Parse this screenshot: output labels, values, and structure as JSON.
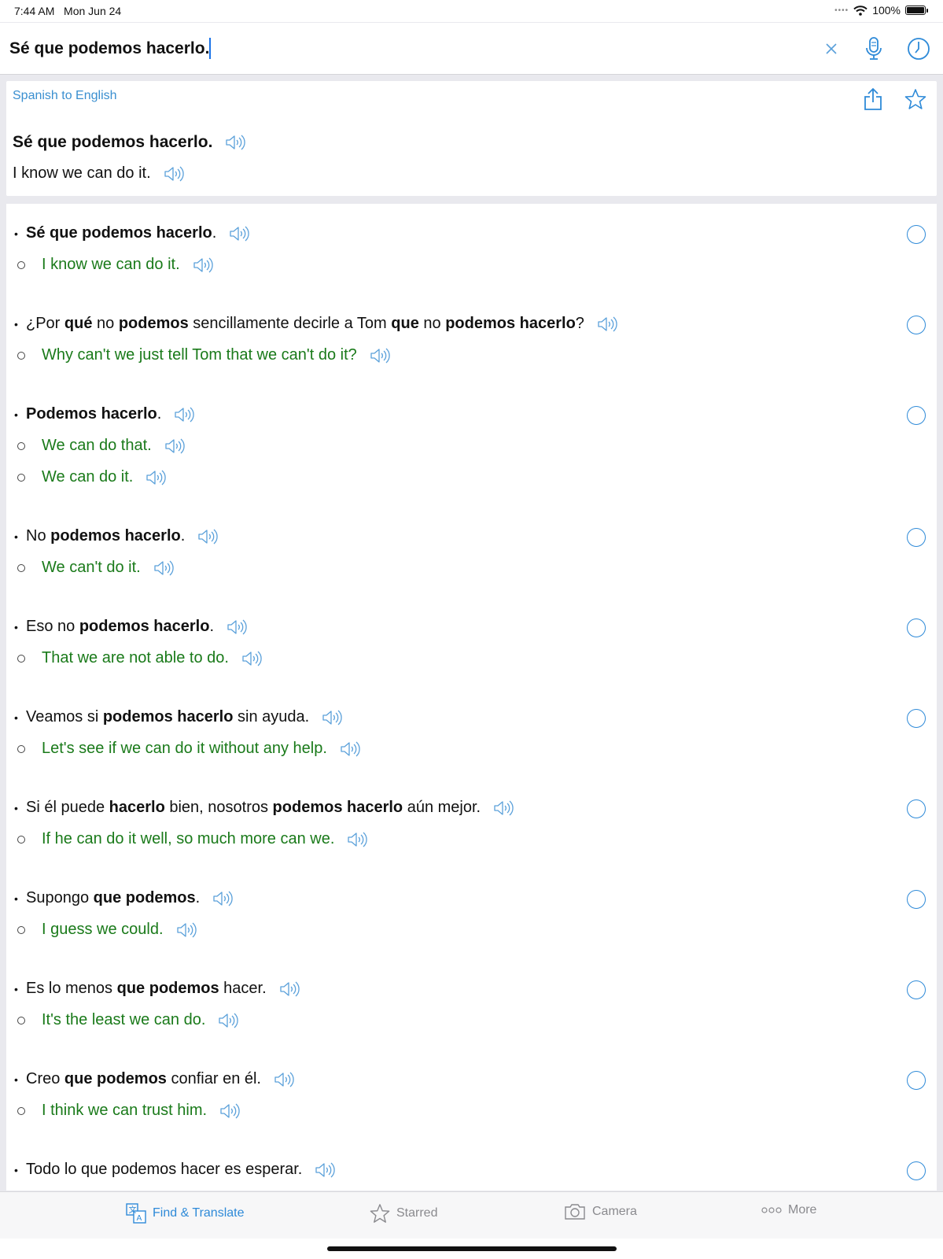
{
  "status": {
    "time": "7:44 AM",
    "date": "Mon Jun 24",
    "battery": "100%"
  },
  "search": {
    "value": "Sé que podemos hacerlo.",
    "placeholder": ""
  },
  "result": {
    "lang_label": "Spanish to English",
    "original": "Sé que podemos hacerlo.",
    "translation": "I know we can do it."
  },
  "examples": [
    {
      "es": [
        [
          "Sé que podemos hacerlo",
          true
        ],
        [
          ".",
          false
        ]
      ],
      "en": [
        "I know we can do it."
      ]
    },
    {
      "es": [
        [
          "¿Por ",
          false
        ],
        [
          "qué",
          true
        ],
        [
          " no ",
          false
        ],
        [
          "podemos",
          true
        ],
        [
          " sencillamente decirle a Tom ",
          false
        ],
        [
          "que",
          true
        ],
        [
          " no ",
          false
        ],
        [
          "podemos hacerlo",
          true
        ],
        [
          "?",
          false
        ]
      ],
      "en": [
        "Why can't we just tell Tom that we can't do it?"
      ]
    },
    {
      "es": [
        [
          "Podemos hacerlo",
          true
        ],
        [
          ".",
          false
        ]
      ],
      "en": [
        "We can do that.",
        "We can do it."
      ]
    },
    {
      "es": [
        [
          "No ",
          false
        ],
        [
          "podemos hacerlo",
          true
        ],
        [
          ".",
          false
        ]
      ],
      "en": [
        "We can't do it."
      ]
    },
    {
      "es": [
        [
          "Eso no ",
          false
        ],
        [
          "podemos hacerlo",
          true
        ],
        [
          ".",
          false
        ]
      ],
      "en": [
        "That we are not able to do."
      ]
    },
    {
      "es": [
        [
          "Veamos si ",
          false
        ],
        [
          "podemos hacerlo",
          true
        ],
        [
          " sin ayuda.",
          false
        ]
      ],
      "en": [
        "Let's see if we can do it without any help."
      ]
    },
    {
      "es": [
        [
          "Si él puede ",
          false
        ],
        [
          "hacerlo",
          true
        ],
        [
          " bien, nosotros ",
          false
        ],
        [
          "podemos hacerlo",
          true
        ],
        [
          " aún mejor.",
          false
        ]
      ],
      "en": [
        "If he can do it well, so much more can we."
      ]
    },
    {
      "es": [
        [
          "Supongo ",
          false
        ],
        [
          "que podemos",
          true
        ],
        [
          ".",
          false
        ]
      ],
      "en": [
        "I guess we could."
      ]
    },
    {
      "es": [
        [
          "Es lo menos ",
          false
        ],
        [
          "que podemos",
          true
        ],
        [
          " hacer.",
          false
        ]
      ],
      "en": [
        "It's the least we can do."
      ]
    },
    {
      "es": [
        [
          "Creo ",
          false
        ],
        [
          "que podemos",
          true
        ],
        [
          " confiar en él.",
          false
        ]
      ],
      "en": [
        "I think we can trust him."
      ]
    },
    {
      "es": [
        [
          "Todo lo que podemos hacer es esperar.",
          false
        ]
      ],
      "en": []
    }
  ],
  "tabs": [
    {
      "label": "Find & Translate",
      "icon": "translate-icon",
      "active": true
    },
    {
      "label": "Starred",
      "icon": "star-icon",
      "active": false
    },
    {
      "label": "Camera",
      "icon": "camera-icon",
      "active": false
    },
    {
      "label": "More",
      "icon": "more-dots-icon",
      "active": false
    }
  ],
  "colors": {
    "accent": "#2e8ad8",
    "translation": "#1a7a1a",
    "lang_label": "#3a8fd0"
  }
}
